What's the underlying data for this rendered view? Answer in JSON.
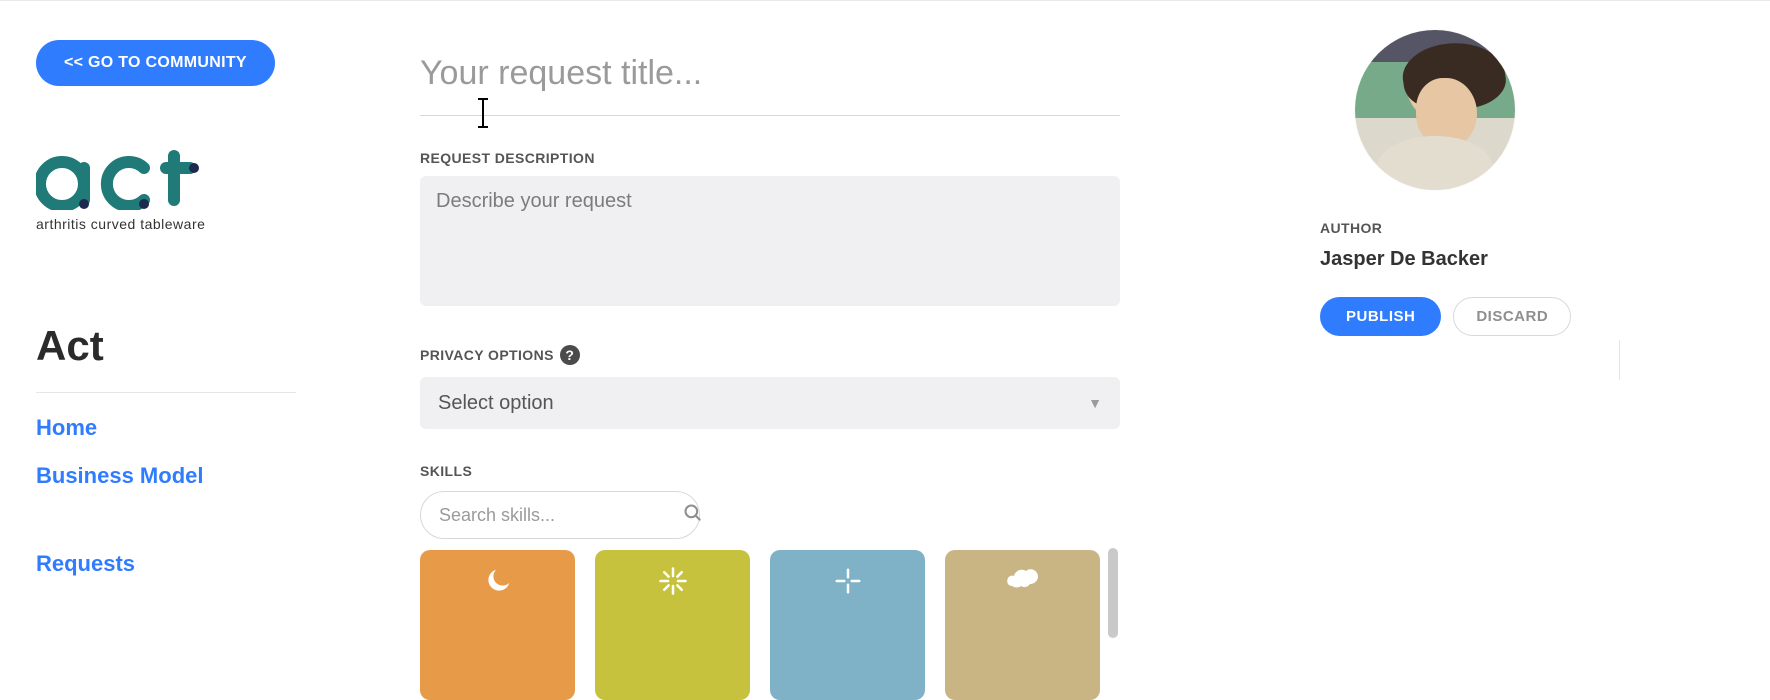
{
  "sidebar": {
    "community_btn": "<< GO TO COMMUNITY",
    "logo_tagline": "arthritis  curved  tableware",
    "section_title": "Act",
    "nav": {
      "home": "Home",
      "business_model": "Business Model",
      "requests": "Requests"
    }
  },
  "form": {
    "title_placeholder": "Your request title...",
    "description_label": "REQUEST DESCRIPTION",
    "description_placeholder": "Describe your request",
    "privacy_label": "PRIVACY OPTIONS",
    "help_symbol": "?",
    "privacy_select_placeholder": "Select option",
    "skills_label": "SKILLS",
    "skills_search_placeholder": "Search skills..."
  },
  "tiles": {
    "colors": [
      "orange",
      "olive",
      "blue",
      "sand"
    ]
  },
  "author_panel": {
    "label": "AUTHOR",
    "name": "Jasper De Backer",
    "publish": "PUBLISH",
    "discard": "DISCARD"
  }
}
